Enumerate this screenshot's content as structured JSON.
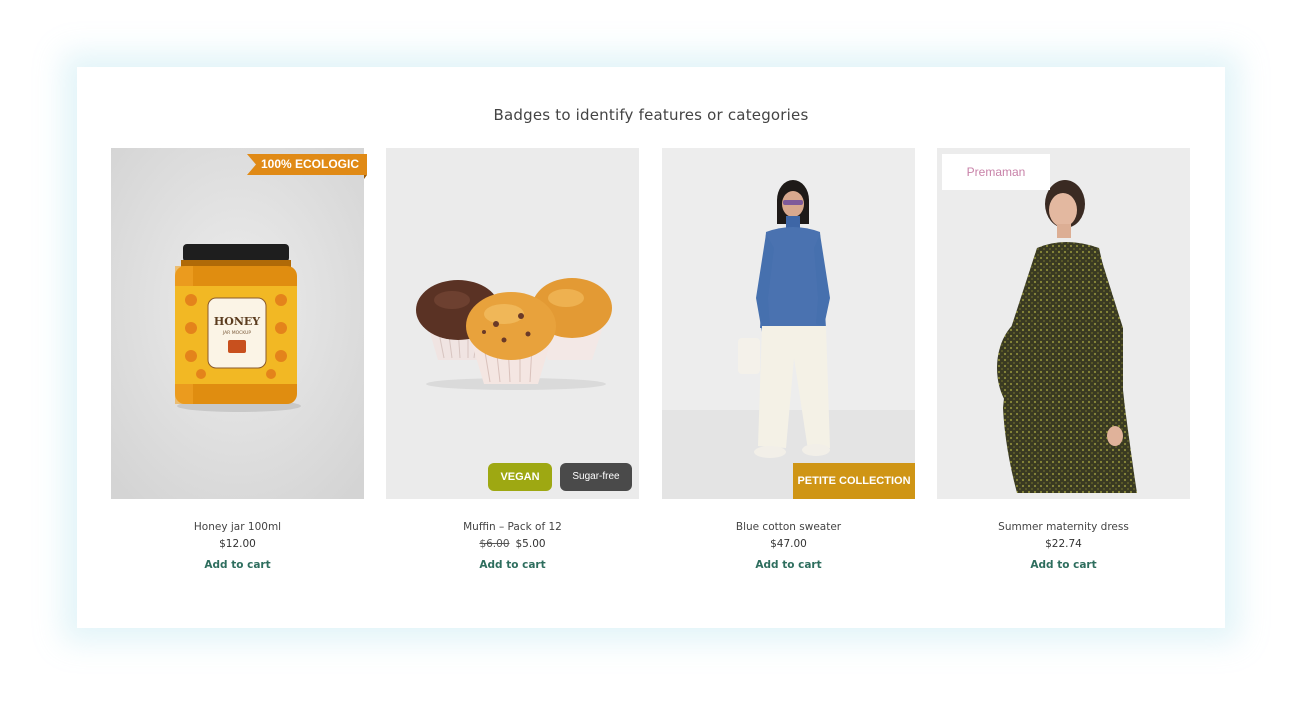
{
  "heading": "Badges to identify features or categories",
  "products": [
    {
      "name": "Honey jar 100ml",
      "price": "$12.00",
      "cta": "Add to cart",
      "badges": [
        "100% ECOLOGIC"
      ],
      "label_text": [
        "HONEY",
        "JAR MOCKUP"
      ]
    },
    {
      "name": "Muffin – Pack of 12",
      "old_price": "$6.00",
      "price": "$5.00",
      "cta": "Add to cart",
      "badges": [
        "VEGAN",
        "Sugar-free"
      ]
    },
    {
      "name": "Blue cotton sweater",
      "price": "$47.00",
      "cta": "Add to cart",
      "badges": [
        "PETITE COLLECTION"
      ]
    },
    {
      "name": "Summer maternity dress",
      "price": "$22.74",
      "cta": "Add to cart",
      "badges": [
        "Premaman"
      ]
    }
  ],
  "colors": {
    "badge_ecologic": "#e08a16",
    "badge_vegan": "#9ea812",
    "badge_sugar_free": "#4a4a4a",
    "badge_petite": "#cf9515",
    "badge_premaman_text": "#c882a8",
    "add_to_cart": "#2e6e5e"
  }
}
